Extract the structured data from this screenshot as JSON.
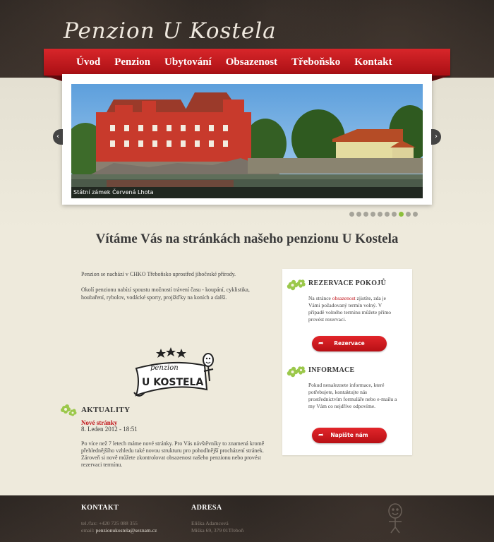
{
  "site": {
    "logo": "Penzion U Kostela"
  },
  "nav": {
    "items": [
      "Úvod",
      "Penzion",
      "Ubytování",
      "Obsazenost",
      "Třeboňsko",
      "Kontakt"
    ]
  },
  "slider": {
    "caption": "Státní zámek Červená Lhota",
    "prev_icon": "chevron-left-icon",
    "next_icon": "chevron-right-icon",
    "prev_glyph": "‹",
    "next_glyph": "›",
    "dot_count": 10,
    "active_dot": 8
  },
  "main": {
    "welcome_title": "Vítáme Vás na stránkách našeho penzionu U Kostela",
    "intro_p1": "Penzion se nachází v CHKO Třeboňsko uprostřed jihočeské přírody.",
    "intro_p2": "Okolí penzionu nabízí spoustu možností trávení času - koupání, cyklistika, houbaření, rybolov, vodácké sporty, projížďky na koních a další."
  },
  "emblem": {
    "line1": "penzion",
    "line2": "U KOSTELA"
  },
  "news": {
    "heading": "AKTUALITY",
    "item_title": "Nové stránky",
    "item_date": "8. Leden 2012 - 18:51",
    "item_body": "Po více než 7 letech máme nové stránky. Pro Vás návštěvníky to znamená kromě přehlednějšího vzhledu také novou strukturu pro pohodlnější procházení stránek. Zároveň si nově můžete zkontrolovat obsazenost našeho penzionu nebo provést rezervaci termínu."
  },
  "sidebar": {
    "reservation": {
      "title": "REZERVACE POKOJŮ",
      "text_before": "Na stránce ",
      "link": "obsazenost",
      "text_after": " zjistíte, zda je Vámi požadovaný termín volný. V případě volného termínu můžete přímo provést rezervaci.",
      "button": "Rezervace",
      "button_icon": "arrow-right-icon"
    },
    "info": {
      "title": "INFORMACE",
      "text": "Pokud nenaleznete informace, které potřebujete, kontaktujte nás prostřednictvím formuláře nebo e-mailu a my Vám co nejdříve odpovíme.",
      "button": "Napište nám",
      "button_icon": "arrow-right-icon"
    }
  },
  "footer": {
    "contact": {
      "heading": "KONTAKT",
      "phone": "tel./fax: +420 725 088 355",
      "email_label": "email: ",
      "email": "penzionukostela@seznam.cz"
    },
    "address": {
      "heading": "ADRESA",
      "name": "Eliška Adamcová",
      "street": "Miška 69, 379 01Třeboň"
    }
  },
  "colors": {
    "accent": "#c1141a",
    "dot_active": "#8cbf3a",
    "header_bg": "#2c2622",
    "page_bg": "#eeeadc"
  }
}
